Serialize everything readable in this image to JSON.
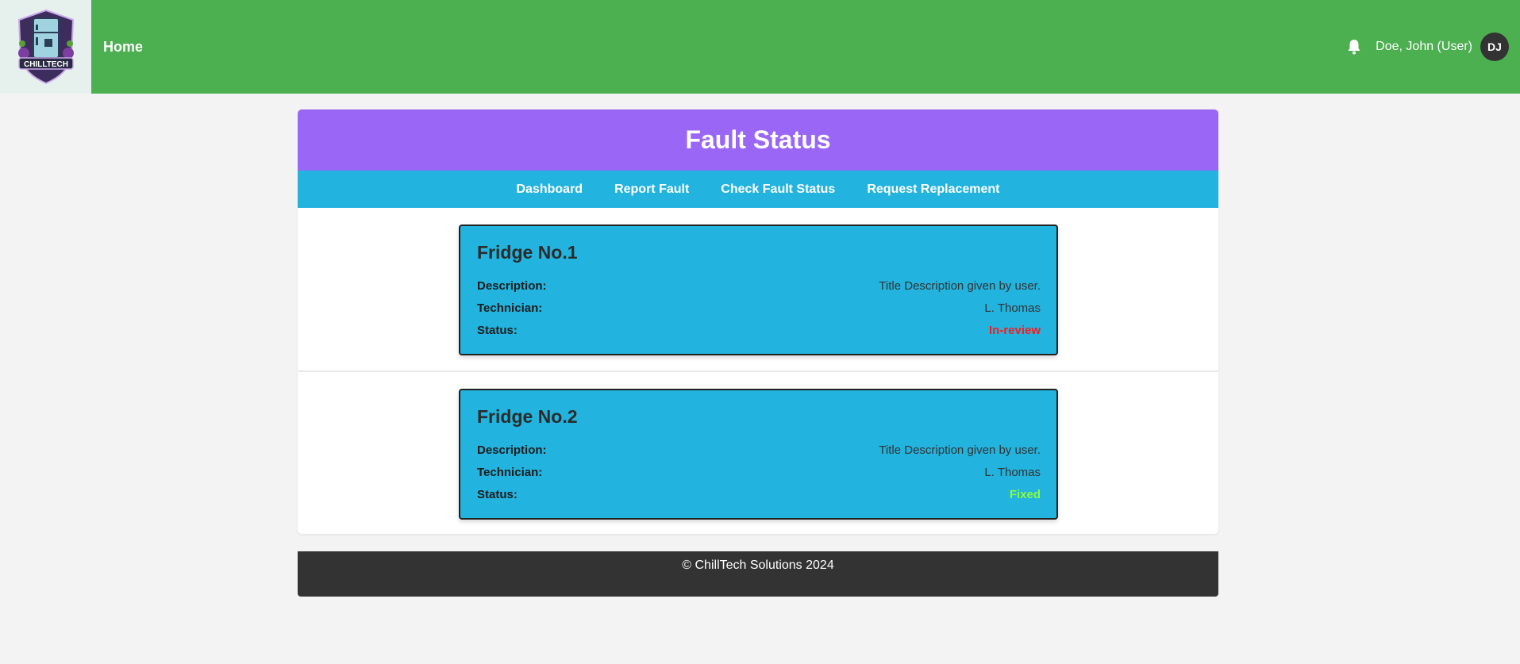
{
  "topbar": {
    "logo_text": "CHILLTECH",
    "home_label": "Home",
    "user_label": "Doe, John (User)",
    "avatar_initials": "DJ",
    "icons": {
      "notifications": "bell-icon"
    }
  },
  "page": {
    "title": "Fault Status"
  },
  "subnav": {
    "items": [
      {
        "label": "Dashboard"
      },
      {
        "label": "Report Fault"
      },
      {
        "label": "Check Fault Status"
      },
      {
        "label": "Request Replacement"
      }
    ]
  },
  "faults": [
    {
      "title": "Fridge No.1",
      "description_label": "Description:",
      "description": "Title Description given by user.",
      "technician_label": "Technician:",
      "technician": "L. Thomas",
      "status_label": "Status:",
      "status": "In-review",
      "status_color": "#ff1a1a"
    },
    {
      "title": "Fridge No.2",
      "description_label": "Description:",
      "description": "Title Description given by user.",
      "technician_label": "Technician:",
      "technician": "L. Thomas",
      "status_label": "Status:",
      "status": "Fixed",
      "status_color": "#8aff3b"
    }
  ],
  "footer": {
    "text": "© ChillTech Solutions 2024"
  },
  "colors": {
    "topbar": "#4caf50",
    "header": "#9966f5",
    "subnav": "#22b3de",
    "card": "#22b3de",
    "footer": "#333333"
  }
}
